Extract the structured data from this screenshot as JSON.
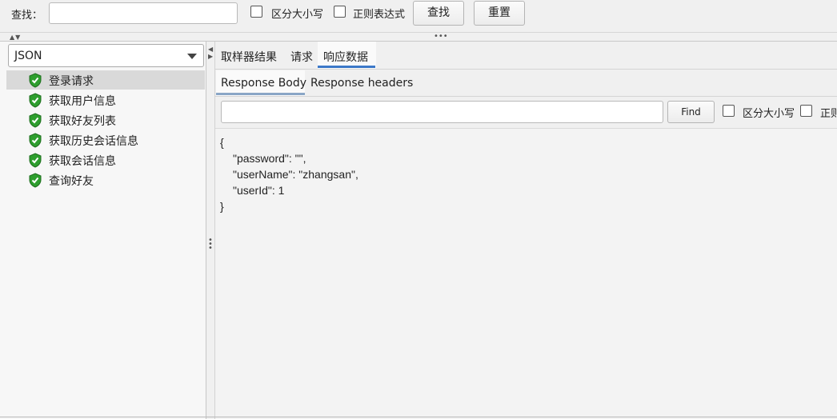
{
  "search_bar": {
    "label": "查找：",
    "input_value": "",
    "case_sensitive_label": "区分大小写",
    "regex_label": "正则表达式",
    "find_button": "查找",
    "reset_button": "重置"
  },
  "left_panel": {
    "renderer_select": "JSON",
    "tree_items": [
      {
        "label": "登录请求",
        "status": "success"
      },
      {
        "label": "获取用户信息",
        "status": "success"
      },
      {
        "label": "获取好友列表",
        "status": "success"
      },
      {
        "label": "获取历史会话信息",
        "status": "success"
      },
      {
        "label": "获取会话信息",
        "status": "success"
      },
      {
        "label": "查询好友",
        "status": "success"
      }
    ]
  },
  "result_tabs": {
    "tabs": [
      "取样器结果",
      "请求",
      "响应数据"
    ],
    "active": "响应数据"
  },
  "response_tabs": {
    "tabs": [
      "Response Body",
      "Response headers"
    ],
    "active": "Response Body"
  },
  "find_bar": {
    "input_value": "",
    "find_button": "Find",
    "case_sensitive_label": "区分大小写",
    "regex_label_partial": "正则"
  },
  "response_body": {
    "lines": [
      "{",
      "\"password\": \"\",",
      "\"userName\": \"zhangsan\",",
      "\"userId\": 1",
      "}"
    ]
  },
  "colors": {
    "accent_underline": "#3c78c8",
    "selected_row": "#d9d9d9",
    "success_icon": "#2e9e2e"
  }
}
